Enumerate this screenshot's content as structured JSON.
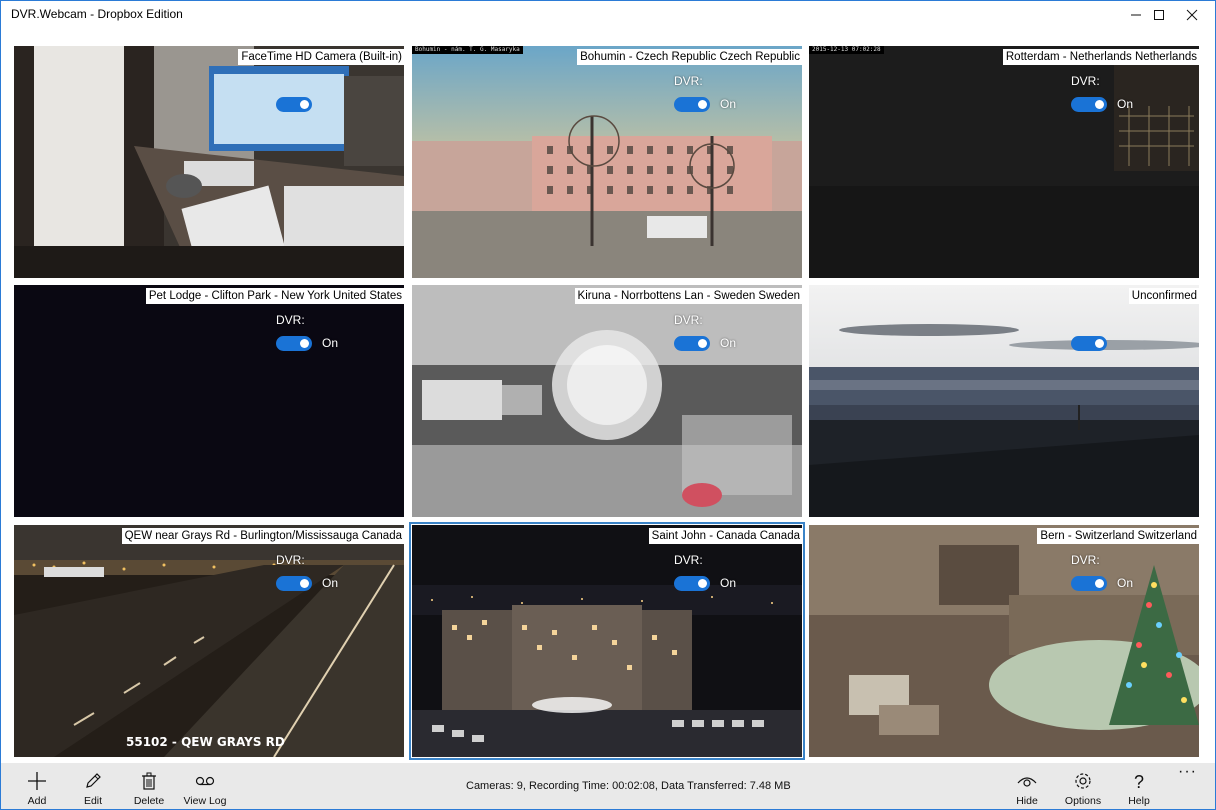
{
  "window": {
    "title": "DVR.Webcam - Dropbox Edition"
  },
  "cameras": [
    {
      "name": "FaceTime HD Camera (Built-in)",
      "dvr_label": "DVR:",
      "toggle_state": "",
      "stamp": ""
    },
    {
      "name": "Bohumin - Czech Republic Czech Republic",
      "dvr_label": "DVR:",
      "toggle_state": "On",
      "stamp": "Bohumin - nám. T. G. Masaryka"
    },
    {
      "name": "Rotterdam - Netherlands Netherlands",
      "dvr_label": "DVR:",
      "toggle_state": "On",
      "stamp": "2015-12-13 07:02:28"
    },
    {
      "name": "Pet Lodge - Clifton Park - New York United States",
      "dvr_label": "DVR:",
      "toggle_state": "On",
      "stamp": ""
    },
    {
      "name": "Kiruna - Norrbottens Lan - Sweden Sweden",
      "dvr_label": "DVR:",
      "toggle_state": "On",
      "stamp": ""
    },
    {
      "name": "Unconfirmed",
      "dvr_label": "",
      "toggle_state": "",
      "stamp": ""
    },
    {
      "name": "QEW near Grays Rd - Burlington/Mississauga Canada",
      "dvr_label": "DVR:",
      "toggle_state": "On",
      "stamp": "",
      "sign": "55102 - QEW GRAYS RD"
    },
    {
      "name": "Saint John - Canada Canada",
      "dvr_label": "DVR:",
      "toggle_state": "On",
      "stamp": ""
    },
    {
      "name": "Bern - Switzerland Switzerland",
      "dvr_label": "DVR:",
      "toggle_state": "On",
      "stamp": ""
    }
  ],
  "commandbar": {
    "add": "Add",
    "edit": "Edit",
    "delete": "Delete",
    "view_log": "View Log",
    "status": "Cameras: 9, Recording Time: 00:02:08, Data Transferred: 7.48 MB",
    "hide": "Hide",
    "options": "Options",
    "help": "Help",
    "more": "···"
  },
  "colors": {
    "accent": "#1a73d6",
    "selection": "#3b84c8",
    "commandbar_bg": "#e9e9e9"
  }
}
